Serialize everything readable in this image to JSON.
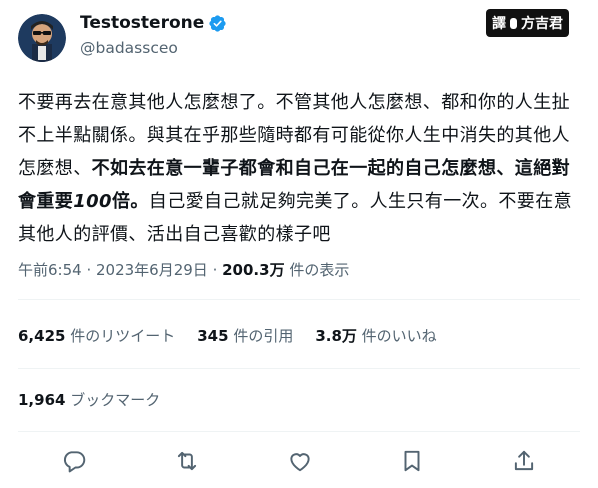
{
  "author": {
    "name": "Testosterone",
    "handle": "@badassceo"
  },
  "translate_badge": {
    "left": "譯",
    "right": "方吉君"
  },
  "tweet": {
    "part1": "不要再去在意其他人怎麼想了。不管其他人怎麼想、都和你的人生扯不上半點關係。與其在乎那些隨時都有可能從你人生中消失的其他人怎麼想、",
    "part2_bold": "不如去在意一輩子都會和自己在一起的自己怎麼想、這絕對會重要",
    "part3_bold_italic": "100",
    "part4_bold": "倍。",
    "part5": "自己愛自己就足夠完美了。人生只有一次。不要在意其他人的評價、活出自己喜歡的樣子吧"
  },
  "meta": {
    "time": "午前6:54",
    "sep1": " · ",
    "date": "2023年6月29日",
    "sep2": " · ",
    "views": "200.3万",
    "views_label": " 件の表示"
  },
  "stats": {
    "retweets": "6,425",
    "retweets_label": " 件のリツイート",
    "quotes": "345",
    "quotes_label": " 件の引用",
    "likes": "3.8万",
    "likes_label": " 件のいいね"
  },
  "bookmarks": {
    "count": "1,964",
    "label": " ブックマーク"
  },
  "icons": {
    "reply": "reply-icon",
    "retweet": "retweet-icon",
    "like": "like-icon",
    "bookmark": "bookmark-icon",
    "share": "share-icon",
    "verified": "verified-badge-icon"
  },
  "colors": {
    "verified": "#1d9bf0",
    "muted": "#536471",
    "text": "#0f1419"
  }
}
